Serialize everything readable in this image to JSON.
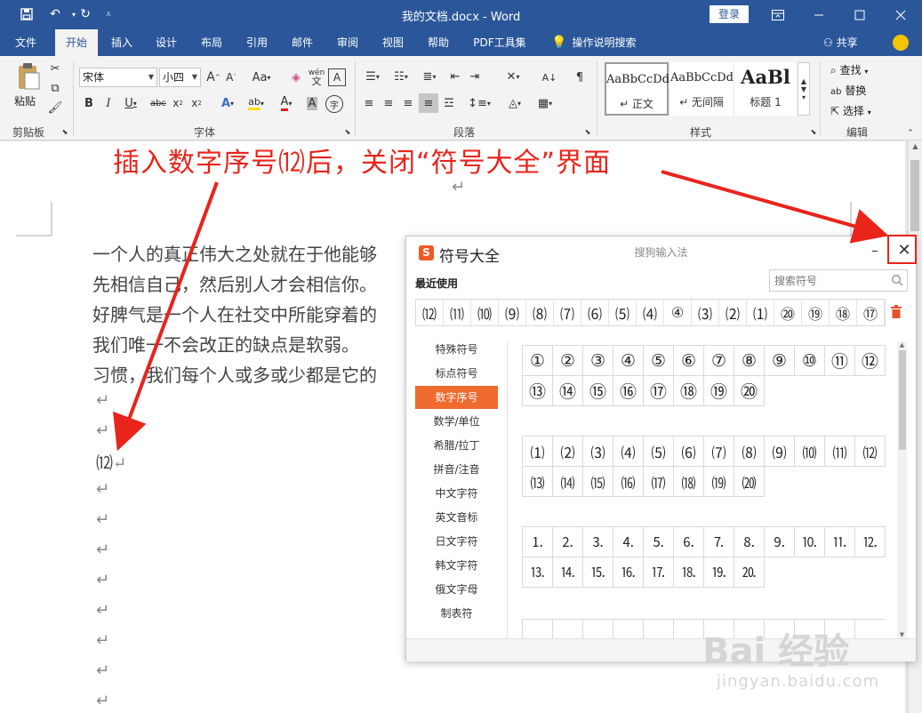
{
  "titlebar": {
    "title": "我的文档.docx  -  Word",
    "login": "登录"
  },
  "tabs": [
    "文件",
    "开始",
    "插入",
    "设计",
    "布局",
    "引用",
    "邮件",
    "审阅",
    "视图",
    "帮助",
    "PDF工具集"
  ],
  "active_tab": "开始",
  "tell_me": "操作说明搜索",
  "share": "共享",
  "ribbon": {
    "clipboard": {
      "paste": "粘贴",
      "label": "剪贴板"
    },
    "font": {
      "name": "宋体",
      "size": "小四",
      "label": "字体",
      "aa": "Aa",
      "wen": "wén",
      "A": "A"
    },
    "paragraph": {
      "label": "段落"
    },
    "styles": {
      "label": "样式",
      "items": [
        {
          "sample": "AaBbCcDd",
          "name": "↵ 正文"
        },
        {
          "sample": "AaBbCcDd",
          "name": "↵ 无间隔"
        },
        {
          "sample": "AaBl",
          "name": "标题 1"
        }
      ]
    },
    "editing": {
      "find": "查找",
      "replace": "替换",
      "select": "选择",
      "label": "编辑"
    }
  },
  "annotation": "插入数字序号⑿后，关闭“符号大全”界面",
  "document": {
    "lines": [
      "一个人的真正伟大之处就在于他能够",
      "先相信自己，然后别人才会相信你。",
      "好脾气是一个人在社交中所能穿着的",
      "我们唯一不会改正的缺点是软弱。",
      "习惯，我们每个人或多或少都是它的"
    ],
    "inserted": "⑿",
    "para_mark": "↵"
  },
  "dialog": {
    "title": "符号大全",
    "subtitle": "搜狗输入法",
    "recent_label": "最近使用",
    "search_placeholder": "搜索符号",
    "recent": [
      "⑿",
      "⑾",
      "⑽",
      "⑼",
      "⑻",
      "⑺",
      "⑹",
      "⑸",
      "⑷",
      "④",
      "⑶",
      "⑵",
      "⑴",
      "⑳",
      "⑲",
      "⑱",
      "⑰"
    ],
    "categories": [
      "特殊符号",
      "标点符号",
      "数字序号",
      "数学/单位",
      "希腊/拉丁",
      "拼音/注音",
      "中文字符",
      "英文音标",
      "日文字符",
      "韩文字符",
      "俄文字母",
      "制表符"
    ],
    "active_category": "数字序号",
    "circled": [
      "①",
      "②",
      "③",
      "④",
      "⑤",
      "⑥",
      "⑦",
      "⑧",
      "⑨",
      "⑩",
      "⑪",
      "⑫",
      "⑬",
      "⑭",
      "⑮",
      "⑯",
      "⑰",
      "⑱",
      "⑲",
      "⑳"
    ],
    "parenthesized": [
      "⑴",
      "⑵",
      "⑶",
      "⑷",
      "⑸",
      "⑹",
      "⑺",
      "⑻",
      "⑼",
      "⑽",
      "⑾",
      "⑿",
      "⒀",
      "⒁",
      "⒂",
      "⒃",
      "⒄",
      "⒅",
      "⒆",
      "⒇"
    ],
    "dotted": [
      "⒈",
      "⒉",
      "⒊",
      "⒋",
      "⒌",
      "⒍",
      "⒎",
      "⒏",
      "⒐",
      "⒑",
      "⒒",
      "⒓",
      "⒔",
      "⒕",
      "⒖",
      "⒗",
      "⒘",
      "⒙",
      "⒚",
      "⒛"
    ]
  },
  "watermark": {
    "main": "Bai 经验",
    "sub": "jingyan.baidu.com"
  },
  "colors": {
    "word_blue": "#2b579a",
    "annotation_red": "#e8241b",
    "sogou_orange": "#f06a30"
  }
}
